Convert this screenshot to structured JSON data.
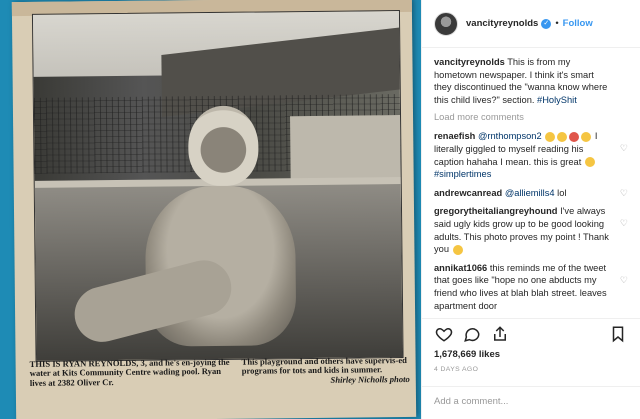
{
  "header": {
    "username": "vancityreynolds",
    "verified_icon": "verified-badge-icon",
    "separator": "•",
    "follow_label": "Follow"
  },
  "caption": {
    "username": "vancityreynolds",
    "text": " This is from my hometown newspaper. I think it's smart they discontinued the \"wanna know where this child lives?\" section. ",
    "hashtag": "#HolyShit"
  },
  "load_more_label": "Load more comments",
  "comments": [
    {
      "username": "renaefish",
      "mention": "@rnthompson2",
      "text_after": "I literally giggled to myself reading his caption hahaha I mean. this is great",
      "tag": "#simplertimes"
    },
    {
      "username": "andrewcanread",
      "mention": "@alliemills4",
      "text_after": "lol"
    },
    {
      "username": "gregorytheitaliangreyhound",
      "text": "I've always said ugly kids grow up to be good looking adults. This photo proves my point ! Thank you"
    },
    {
      "username": "annikat1066",
      "text": "this reminds me of the tweet that goes like \"hope no one abducts my friend who lives at blah blah street. leaves apartment door"
    }
  ],
  "likes": "1,678,669 likes",
  "time_ago": "4 DAYS AGO",
  "add_comment_placeholder": "Add a comment...",
  "photo": {
    "caption_left": "THIS IS RYAN REYNOLDS, 3, and he's en-joying the water at Kits Community Centre wading pool. Ryan lives at 2382 Oliver Cr.",
    "caption_right": "This playground and others have supervis-ed programs for tots and kids in summer.",
    "credit": "Shirley Nicholls photo"
  },
  "colors": {
    "accent": "#3897f0",
    "link": "#003569",
    "muted": "#999999",
    "text": "#262626",
    "backdrop": "#1e8bb5"
  }
}
